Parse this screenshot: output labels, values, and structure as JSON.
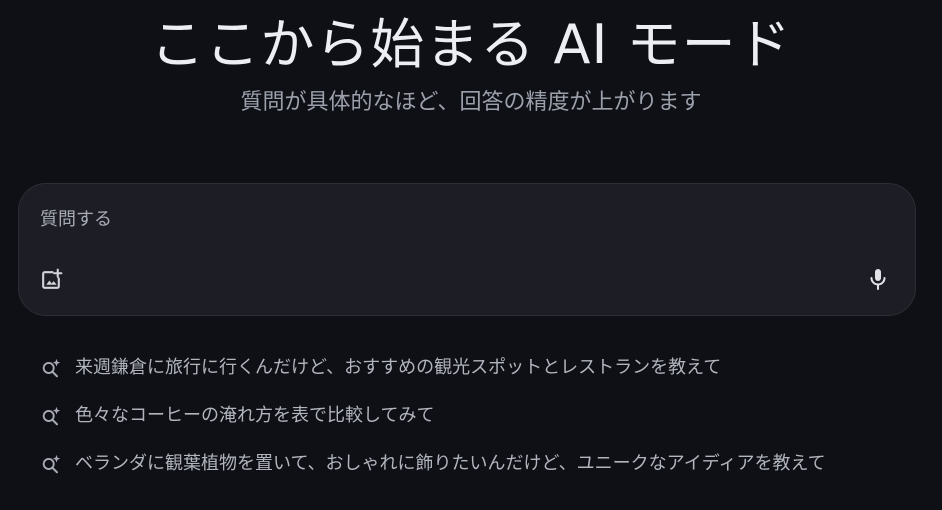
{
  "hero": {
    "title": "ここから始まる AI モード",
    "subtitle": "質問が具体的なほど、回答の精度が上がります"
  },
  "search": {
    "placeholder": "質問する",
    "value": "",
    "image_icon": "add-image-icon",
    "mic_icon": "microphone-icon"
  },
  "suggestions": {
    "icon": "search-sparkle-icon",
    "items": [
      {
        "label": "来週鎌倉に旅行に行くんだけど、おすすめの観光スポットとレストランを教えて"
      },
      {
        "label": "色々なコーヒーの淹れ方を表で比較してみて"
      },
      {
        "label": "ベランダに観葉植物を置いて、おしゃれに飾りたいんだけど、ユニークなアイディアを教えて"
      }
    ]
  },
  "colors": {
    "background": "#0e1016",
    "search_box": "#1d1e25",
    "title": "#eceef3",
    "muted_text": "#9ca0ab"
  }
}
